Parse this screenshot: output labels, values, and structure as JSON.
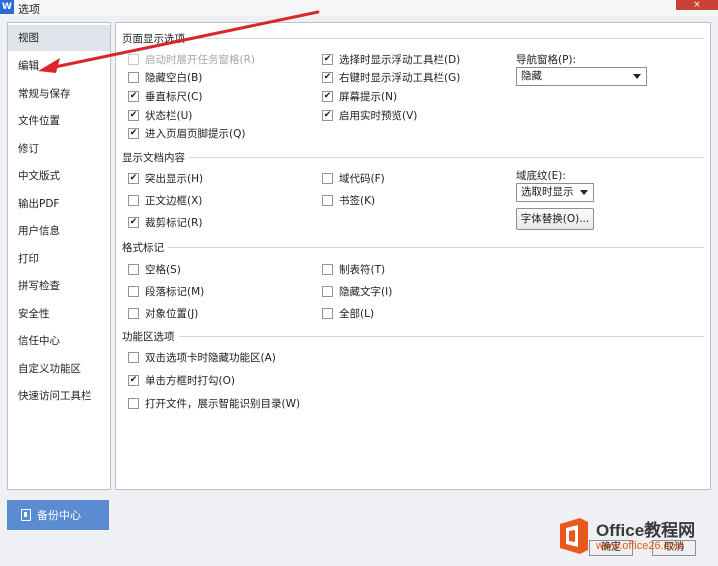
{
  "window": {
    "title": "选项",
    "app_icon": "W",
    "close_label": "×"
  },
  "sidebar": {
    "items": [
      {
        "label": "视图"
      },
      {
        "label": "编辑"
      },
      {
        "label": "常规与保存"
      },
      {
        "label": "文件位置"
      },
      {
        "label": "修订"
      },
      {
        "label": "中文版式"
      },
      {
        "label": "输出PDF"
      },
      {
        "label": "用户信息"
      },
      {
        "label": "打印"
      },
      {
        "label": "拼写检查"
      },
      {
        "label": "安全性"
      },
      {
        "label": "信任中心"
      },
      {
        "label": "自定义功能区"
      },
      {
        "label": "快速访问工具栏"
      }
    ],
    "active_index": 0,
    "backup_label": "备份中心"
  },
  "page_display": {
    "title": "页面显示选项",
    "col1": [
      {
        "label": "启动时展开任务窗格(R)",
        "checked": false,
        "disabled": true
      },
      {
        "label": "隐藏空白(B)",
        "checked": false
      },
      {
        "label": "垂直标尺(C)",
        "checked": true
      },
      {
        "label": "状态栏(U)",
        "checked": true
      },
      {
        "label": "进入页眉页脚提示(Q)",
        "checked": true
      }
    ],
    "col2": [
      {
        "label": "选择时显示浮动工具栏(D)",
        "checked": true
      },
      {
        "label": "右键时显示浮动工具栏(G)",
        "checked": true
      },
      {
        "label": "屏幕提示(N)",
        "checked": true
      },
      {
        "label": "启用实时预览(V)",
        "checked": true
      }
    ],
    "nav_pane_label": "导航窗格(P):",
    "nav_pane_value": "隐藏"
  },
  "doc_content": {
    "title": "显示文档内容",
    "col1": [
      {
        "label": "突出显示(H)",
        "checked": true
      },
      {
        "label": "正文边框(X)",
        "checked": false
      },
      {
        "label": "裁剪标记(R)",
        "checked": true
      }
    ],
    "col2": [
      {
        "label": "域代码(F)",
        "checked": false
      },
      {
        "label": "书签(K)",
        "checked": false
      }
    ],
    "field_shading_label": "域底纹(E):",
    "field_shading_value": "选取时显示",
    "font_replace_button": "字体替换(O)..."
  },
  "format_marks": {
    "title": "格式标记",
    "col1": [
      {
        "label": "空格(S)",
        "checked": false
      },
      {
        "label": "段落标记(M)",
        "checked": false
      },
      {
        "label": "对象位置(J)",
        "checked": false
      }
    ],
    "col2": [
      {
        "label": "制表符(T)",
        "checked": false
      },
      {
        "label": "隐藏文字(I)",
        "checked": false
      },
      {
        "label": "全部(L)",
        "checked": false
      }
    ]
  },
  "ribbon": {
    "title": "功能区选项",
    "items": [
      {
        "label": "双击选项卡时隐藏功能区(A)",
        "checked": false
      },
      {
        "label": "单击方框时打勾(O)",
        "checked": true
      },
      {
        "label": "打开文件，展示智能识别目录(W)",
        "checked": false
      }
    ]
  },
  "footer": {
    "ok_label": "确定",
    "cancel_label": "取消"
  },
  "watermark": {
    "line1": "Office教程网",
    "line2": "www.office26.com"
  },
  "colors": {
    "annotation_arrow": "#d9262a",
    "backup_button": "#5b8bd0",
    "watermark_orange": "#e8571e"
  }
}
